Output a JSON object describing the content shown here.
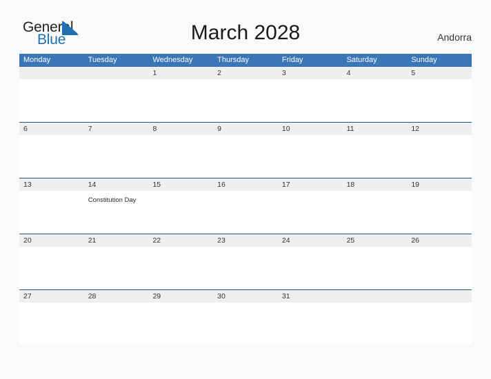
{
  "brand": {
    "name_part1": "General",
    "name_part2": "Blue",
    "triangle_color": "#1f6fb5",
    "text_color": "#231f20"
  },
  "header": {
    "title": "March 2028",
    "locale": "Andorra"
  },
  "colors": {
    "weekday_header_bg": "#3a76b8",
    "weekday_header_text": "#ffffff",
    "date_band_bg": "#efefef",
    "week_rule": "#1f5a96",
    "page_bg": "#fafafa",
    "cell_bg": "#ffffff"
  },
  "calendar": {
    "month": "March",
    "year": "2028",
    "weekdays": [
      "Monday",
      "Tuesday",
      "Wednesday",
      "Thursday",
      "Friday",
      "Saturday",
      "Sunday"
    ],
    "weeks": [
      {
        "dates": [
          "",
          "",
          "1",
          "2",
          "3",
          "4",
          "5"
        ],
        "events": [
          "",
          "",
          "",
          "",
          "",
          "",
          ""
        ]
      },
      {
        "dates": [
          "6",
          "7",
          "8",
          "9",
          "10",
          "11",
          "12"
        ],
        "events": [
          "",
          "",
          "",
          "",
          "",
          "",
          ""
        ]
      },
      {
        "dates": [
          "13",
          "14",
          "15",
          "16",
          "17",
          "18",
          "19"
        ],
        "events": [
          "",
          "Constitution Day",
          "",
          "",
          "",
          "",
          ""
        ]
      },
      {
        "dates": [
          "20",
          "21",
          "22",
          "23",
          "24",
          "25",
          "26"
        ],
        "events": [
          "",
          "",
          "",
          "",
          "",
          "",
          ""
        ]
      },
      {
        "dates": [
          "27",
          "28",
          "29",
          "30",
          "31",
          "",
          ""
        ],
        "events": [
          "",
          "",
          "",
          "",
          "",
          "",
          ""
        ]
      }
    ]
  }
}
